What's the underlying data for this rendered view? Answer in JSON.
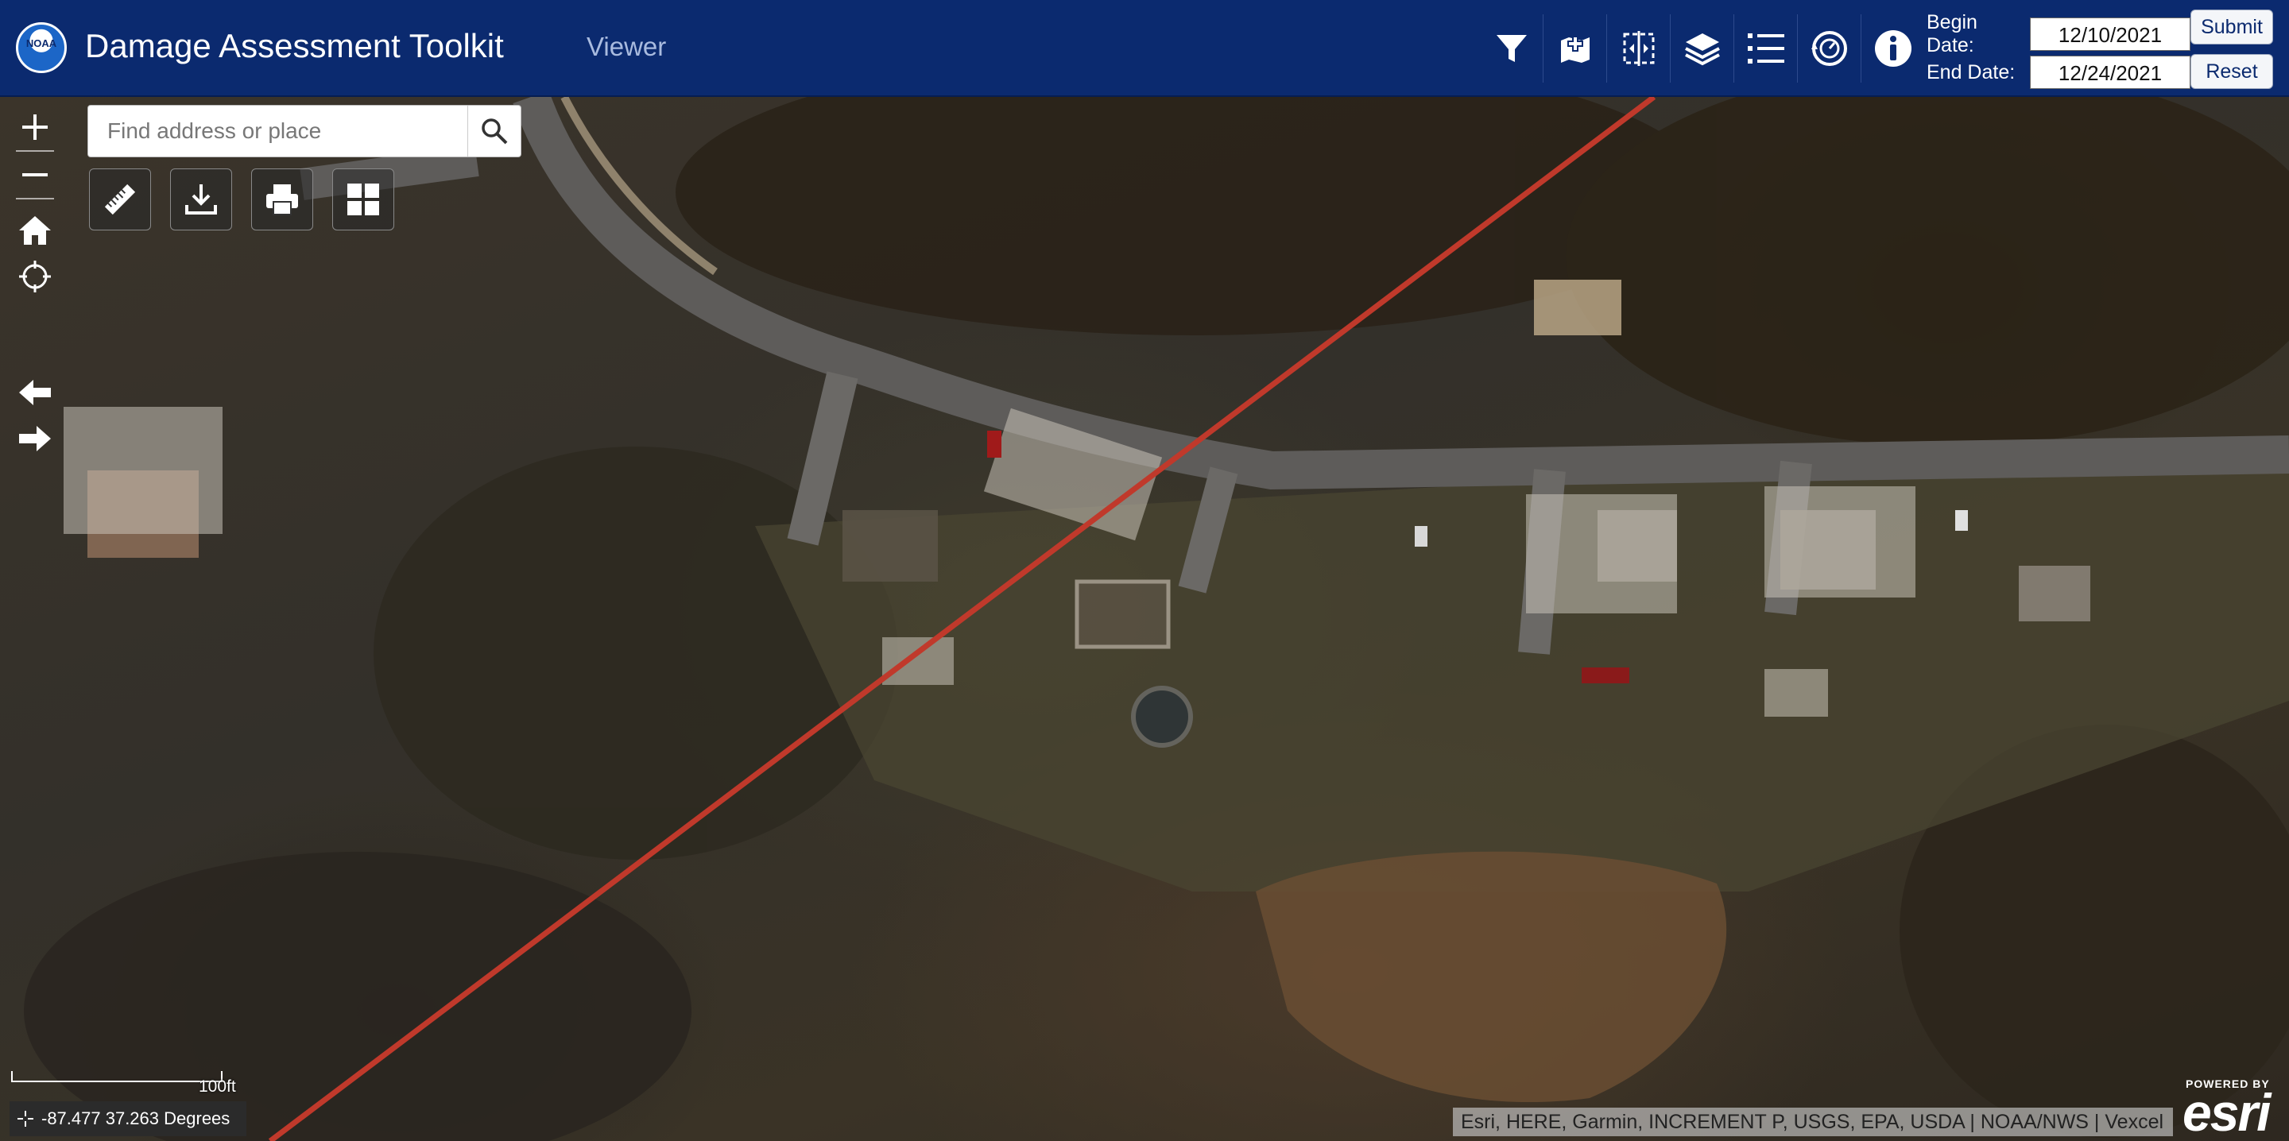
{
  "header": {
    "logo_text": "NOAA",
    "title": "Damage Assessment Toolkit",
    "mode_label": "Viewer",
    "tools": [
      {
        "name": "filter-icon"
      },
      {
        "name": "add-report-icon"
      },
      {
        "name": "swipe-icon"
      },
      {
        "name": "layers-icon"
      },
      {
        "name": "legend-list-icon"
      },
      {
        "name": "time-slider-icon"
      },
      {
        "name": "info-icon"
      }
    ],
    "begin_date_label": "Begin Date:",
    "begin_date_value": "12/10/2021",
    "end_date_label": "End Date:",
    "end_date_value": "12/24/2021",
    "submit_label": "Submit",
    "reset_label": "Reset",
    "colors": {
      "bar": "#0b2a6f",
      "viewer_text": "#a9bbdf"
    }
  },
  "map": {
    "search_placeholder": "Find address or place",
    "controls": [
      "zoom-in",
      "zoom-out",
      "home",
      "locate",
      "previous-extent",
      "next-extent"
    ],
    "widgets": [
      "measure-icon",
      "download-icon",
      "print-icon",
      "basemap-gallery-icon"
    ],
    "scale_label": "100ft",
    "coordinates": "-87.477 37.263 Degrees",
    "attribution": "Esri, HERE, Garmin, INCREMENT P, USGS, EPA, USDA | NOAA/NWS | Vexcel",
    "powered_by": "POWERED BY",
    "esri_logo": "esri",
    "track_line_color": "#c0392b"
  }
}
